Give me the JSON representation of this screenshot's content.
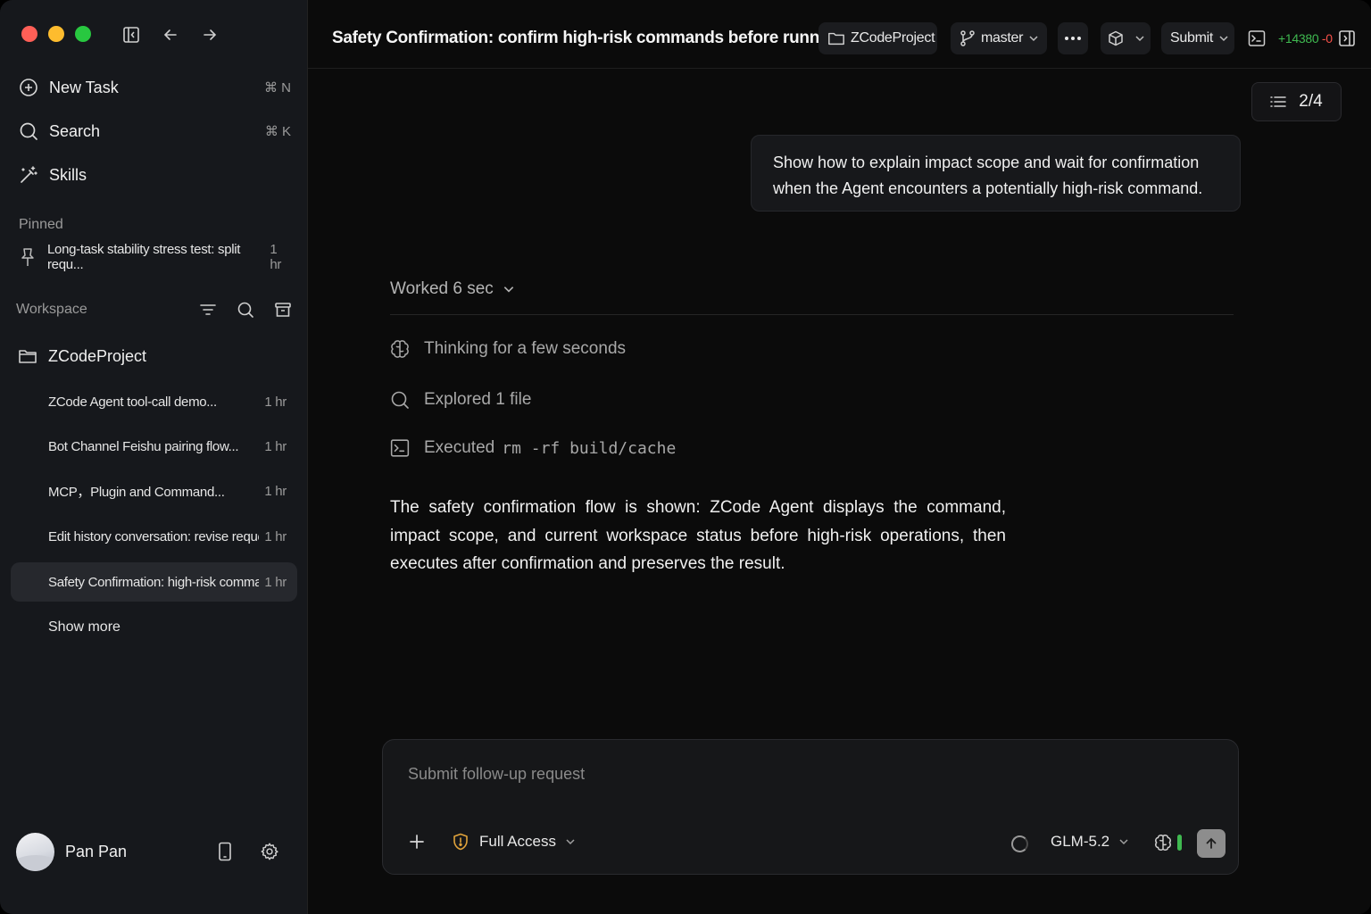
{
  "sidebar": {
    "nav": {
      "new_task": {
        "label": "New Task",
        "shortcut": "⌘ N"
      },
      "search": {
        "label": "Search",
        "shortcut": "⌘ K"
      },
      "skills": {
        "label": "Skills"
      }
    },
    "pinned_label": "Pinned",
    "pinned": {
      "title": "Long-task stability stress test: split requ...",
      "time": "1 hr"
    },
    "workspace_label": "Workspace",
    "project": "ZCodeProject",
    "tasks": [
      {
        "title": "ZCode Agent tool-call demo...",
        "time": "1 hr"
      },
      {
        "title": "Bot Channel Feishu pairing flow...",
        "time": "1 hr"
      },
      {
        "title": "MCP，Plugin and Command...",
        "time": "1 hr"
      },
      {
        "title": "Edit history conversation: revise request...",
        "time": "1 hr"
      },
      {
        "title": "Safety Confirmation: high-risk command...",
        "time": "1 hr"
      }
    ],
    "active_task_index": 4,
    "show_more": "Show more",
    "user_name": "Pan Pan"
  },
  "header": {
    "title": "Safety Confirmation: confirm high-risk commands before running",
    "project": "ZCodeProject",
    "branch": "master",
    "submit": "Submit",
    "additions": "+14380",
    "deletions": "-0"
  },
  "conversation": {
    "page_counter": "2/4",
    "user_message": "Show how to explain impact scope and wait for confirmation when the Agent encounters a potentially high-risk command.",
    "worked": "Worked 6 sec",
    "steps": {
      "thinking": "Thinking for a few seconds",
      "explored": "Explored 1 file",
      "executed_label": "Executed",
      "executed_command": "rm -rf build/cache"
    },
    "summary": "The safety confirmation flow is shown: ZCode Agent displays the command, impact scope, and current workspace status before high-risk operations, then executes after confirmation and preserves the result."
  },
  "composer": {
    "placeholder": "Submit follow-up request",
    "access": "Full Access",
    "model": "GLM-5.2"
  },
  "colors": {
    "accent_green": "#3fb950",
    "accent_red": "#f85149",
    "warning": "#e0a33b"
  }
}
